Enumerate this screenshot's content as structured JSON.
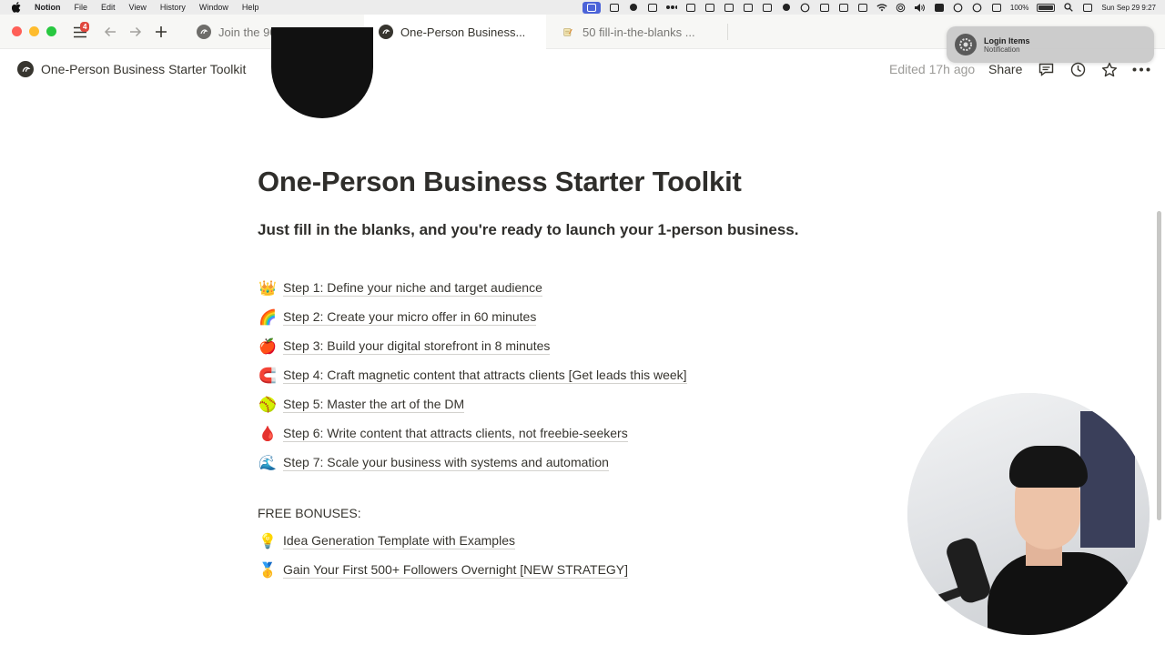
{
  "menubar": {
    "app": "Notion",
    "items": [
      "File",
      "Edit",
      "View",
      "History",
      "Window",
      "Help"
    ],
    "battery": "100%",
    "datetime": "Sun Sep 29  9:27"
  },
  "tabs": {
    "badge": "4",
    "items": [
      {
        "label": "Join the 90-Day Prog..."
      },
      {
        "label": "One-Person Business..."
      },
      {
        "label": "50 fill-in-the-blanks ..."
      }
    ]
  },
  "notification": {
    "title": "Login Items",
    "subtitle": "Notification"
  },
  "header": {
    "title": "One-Person Business Starter Toolkit",
    "edited": "Edited 17h ago",
    "share": "Share"
  },
  "page": {
    "title": "One-Person Business Starter Toolkit",
    "subtitle": "Just fill in the blanks, and you're ready to launch your 1-person business.",
    "steps": [
      {
        "emoji": "👑",
        "label": "Step 1: Define your niche and target audience"
      },
      {
        "emoji": "🌈",
        "label": "Step 2: Create your micro offer in 60 minutes"
      },
      {
        "emoji": "🍎",
        "label": "Step 3: Build your digital storefront in 8 minutes"
      },
      {
        "emoji": "🧲",
        "label": "Step 4: Craft magnetic content that attracts clients [Get leads this week]"
      },
      {
        "emoji": "🥎",
        "label": "Step 5: Master the art of the DM"
      },
      {
        "emoji": "🩸",
        "label": "Step 6: Write content that attracts clients, not freebie-seekers"
      },
      {
        "emoji": "🌊",
        "label": "Step 7: Scale your business with systems and automation"
      }
    ],
    "bonus_heading": "FREE BONUSES:",
    "bonuses": [
      {
        "emoji": "💡",
        "label": "Idea Generation Template with Examples"
      },
      {
        "emoji": "🥇",
        "label": "Gain Your First 500+ Followers Overnight [NEW STRATEGY]"
      }
    ]
  },
  "icons": {
    "apple": "apple-logo-icon",
    "sidebar": "sidebar-toggle-icon",
    "back": "back-arrow-icon",
    "forward": "forward-arrow-icon",
    "new_tab": "plus-icon",
    "comments": "comments-icon",
    "updates": "clock-icon",
    "favorite": "star-icon",
    "more": "more-icon"
  },
  "colors": {
    "text": "#37352f",
    "muted": "#9b9a97",
    "badge": "#e0473d",
    "tabbar": "#f7f7f5"
  }
}
